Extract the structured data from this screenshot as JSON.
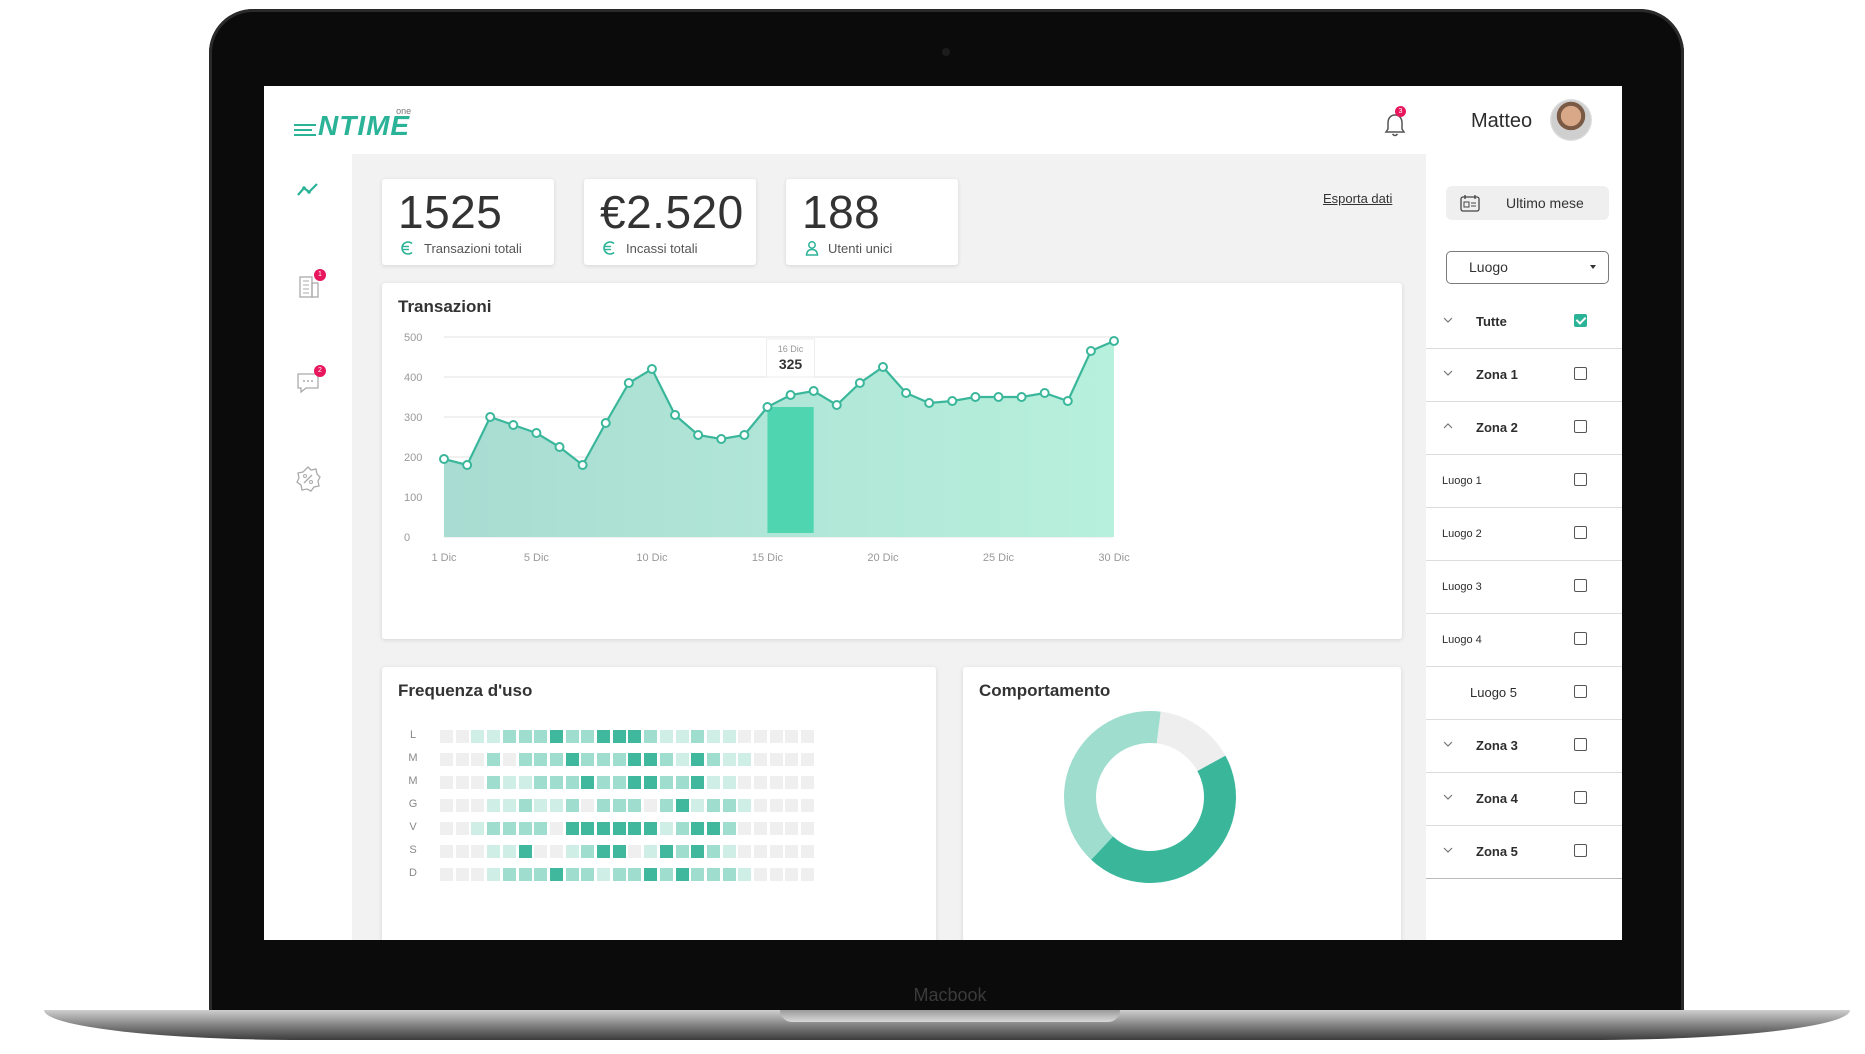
{
  "device": {
    "brand": "Macbook"
  },
  "app": {
    "logo_text": "NTIME",
    "logo_suffix": "one"
  },
  "header": {
    "notifications_count": "3",
    "user_name": "Matteo"
  },
  "sidebar": {
    "items": [
      {
        "name": "analytics",
        "icon": "trend-line-icon",
        "badge": ""
      },
      {
        "name": "buildings",
        "icon": "building-icon",
        "badge": "1"
      },
      {
        "name": "messages",
        "icon": "chat-icon",
        "badge": "2"
      },
      {
        "name": "settings",
        "icon": "gear-percent-icon",
        "badge": ""
      }
    ]
  },
  "stats": [
    {
      "value": "1525",
      "label": "Transazioni totali",
      "icon": "euro-icon"
    },
    {
      "value": "€2.520",
      "label": "Incassi totali",
      "icon": "euro-icon"
    },
    {
      "value": "188",
      "label": "Utenti unici",
      "icon": "user-icon"
    }
  ],
  "export_label": "Esporta dati",
  "filters": {
    "period_label": "Ultimo mese",
    "place_select": "Luogo",
    "items": [
      {
        "label": "Tutte",
        "chevron": "down",
        "checked": true,
        "type": "zone"
      },
      {
        "label": "Zona 1",
        "chevron": "down",
        "checked": false,
        "type": "zone"
      },
      {
        "label": "Zona 2",
        "chevron": "up",
        "checked": false,
        "type": "zone"
      },
      {
        "label": "Luogo 1",
        "chevron": "",
        "checked": false,
        "type": "place"
      },
      {
        "label": "Luogo 2",
        "chevron": "",
        "checked": false,
        "type": "place"
      },
      {
        "label": "Luogo 3",
        "chevron": "",
        "checked": false,
        "type": "place"
      },
      {
        "label": "Luogo 4",
        "chevron": "",
        "checked": false,
        "type": "place"
      },
      {
        "label": "Luogo 5",
        "chevron": "",
        "checked": false,
        "type": "place5"
      },
      {
        "label": "Zona 3",
        "chevron": "down",
        "checked": false,
        "type": "zone"
      },
      {
        "label": "Zona 4",
        "chevron": "down",
        "checked": false,
        "type": "zone"
      },
      {
        "label": "Zona 5",
        "chevron": "down",
        "checked": false,
        "type": "zone"
      }
    ]
  },
  "panels": {
    "transactions_title": "Transazioni",
    "frequency_title": "Frequenza d'uso",
    "behavior_title": "Comportamento"
  },
  "chart_data": [
    {
      "type": "area",
      "title": "Transazioni",
      "x": [
        1,
        2,
        3,
        4,
        5,
        6,
        7,
        8,
        9,
        10,
        11,
        12,
        13,
        14,
        15,
        16,
        17,
        18,
        19,
        20,
        21,
        22,
        23,
        24,
        25,
        26,
        27,
        28,
        29,
        30,
        31
      ],
      "x_tick_labels": [
        "1 Dic",
        "5 Dic",
        "10 Dic",
        "15 Dic",
        "20 Dic",
        "25 Dic",
        "30 Dic"
      ],
      "x_tick_values": [
        1,
        5,
        10,
        15,
        20,
        25,
        30
      ],
      "values": [
        195,
        180,
        300,
        280,
        260,
        225,
        180,
        285,
        385,
        420,
        305,
        255,
        245,
        255,
        325,
        355,
        365,
        330,
        385,
        425,
        360,
        335,
        340,
        350,
        350,
        350,
        360,
        340,
        465,
        490
      ],
      "ylim": [
        0,
        500
      ],
      "y_ticks": [
        0,
        100,
        200,
        300,
        400,
        500
      ],
      "highlight": {
        "label": "16 Dic",
        "value": "325",
        "x": [
          15,
          17
        ]
      },
      "grid": true
    },
    {
      "type": "heatmap",
      "title": "Frequenza d'uso",
      "rows": [
        "L",
        "M",
        "M",
        "G",
        "V",
        "S",
        "D"
      ],
      "levels": [
        [
          0,
          0,
          1,
          1,
          2,
          2,
          2,
          3,
          2,
          2,
          3,
          3,
          3,
          2,
          1,
          1,
          2,
          1,
          1,
          0,
          0,
          0,
          0,
          0
        ],
        [
          0,
          0,
          0,
          2,
          0,
          2,
          2,
          2,
          3,
          2,
          2,
          2,
          3,
          3,
          2,
          1,
          3,
          2,
          1,
          1,
          0,
          0,
          0,
          0
        ],
        [
          0,
          0,
          0,
          2,
          1,
          1,
          2,
          2,
          2,
          3,
          2,
          2,
          3,
          3,
          2,
          2,
          3,
          1,
          1,
          0,
          0,
          0,
          0,
          0
        ],
        [
          0,
          0,
          0,
          1,
          1,
          2,
          1,
          1,
          2,
          0,
          2,
          2,
          2,
          0,
          2,
          3,
          1,
          2,
          2,
          1,
          0,
          0,
          0,
          0
        ],
        [
          0,
          0,
          1,
          2,
          2,
          2,
          2,
          0,
          3,
          3,
          3,
          3,
          3,
          3,
          1,
          2,
          3,
          3,
          2,
          0,
          0,
          0,
          0,
          0
        ],
        [
          0,
          0,
          0,
          1,
          1,
          3,
          0,
          0,
          1,
          2,
          3,
          3,
          0,
          1,
          3,
          2,
          3,
          2,
          1,
          0,
          0,
          0,
          0,
          0
        ],
        [
          0,
          0,
          0,
          1,
          2,
          2,
          2,
          3,
          2,
          2,
          1,
          2,
          2,
          3,
          2,
          3,
          2,
          2,
          2,
          1,
          0,
          0,
          0,
          0
        ]
      ]
    },
    {
      "type": "pie",
      "title": "Comportamento",
      "values": [
        45,
        40,
        15
      ],
      "colors": [
        "#3ab79b",
        "#9fddce",
        "#eeeeee"
      ]
    }
  ],
  "colors": {
    "accent": "#2bb397",
    "badge": "#e8175d"
  }
}
